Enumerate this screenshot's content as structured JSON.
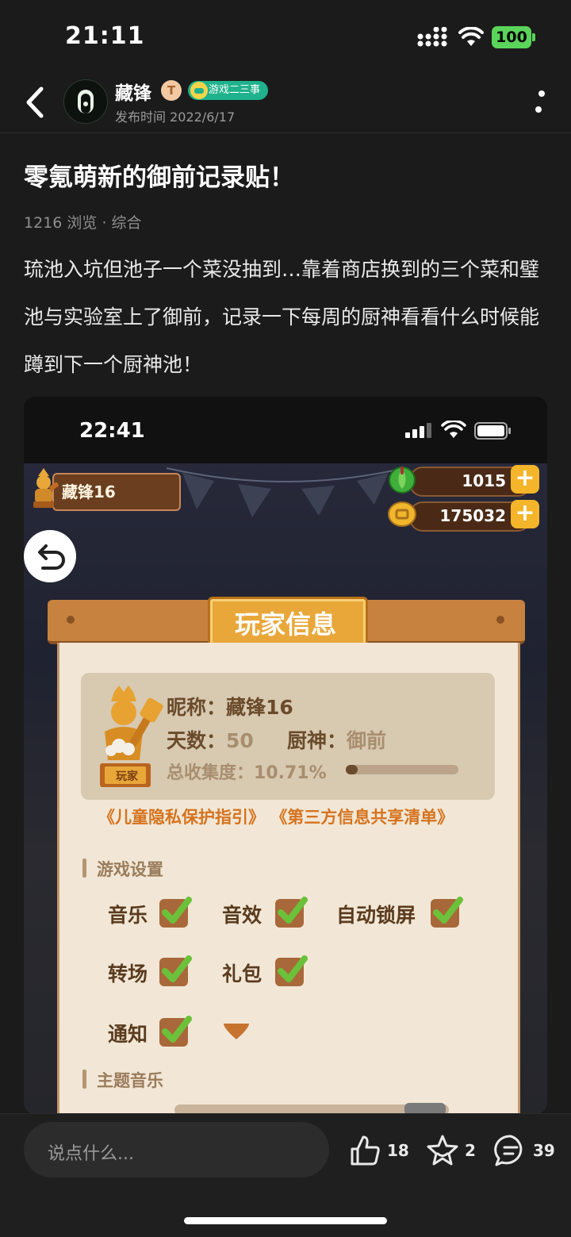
{
  "status_bar": {
    "time": "21:11",
    "battery": "100"
  },
  "header": {
    "author": "藏锋",
    "level_badge": "T",
    "tag": "游戏二三事",
    "publish_time": "发布时间 2022/6/17"
  },
  "post": {
    "title": "零氪萌新的御前记录贴！",
    "views": "1216 浏览",
    "category": "综合",
    "body": "琉池入坑但池子一个菜没抽到…靠着商店换到的三个菜和璧池与实验室上了御前，记录一下每周的厨神看看什么时候能蹲到下一个厨神池！"
  },
  "screenshot": {
    "time": "22:41",
    "player_name": "藏锋16",
    "jade": "1015",
    "coins": "175032",
    "modal_title": "玩家信息",
    "nickname_label": "昵称：",
    "nickname": "藏锋16",
    "days_label": "天数：",
    "days": "50",
    "chef_label": "厨神：",
    "chef": "御前",
    "collection_label": "总收集度：",
    "collection": "10.71%",
    "collection_fraction": 0.1071,
    "statue_label": "玩家",
    "link_privacy": "《儿童隐私保护指引》",
    "link_thirdparty": "《第三方信息共享清单》",
    "section_settings": "游戏设置",
    "settings": {
      "music": "音乐",
      "sfx": "音效",
      "autolock": "自动锁屏",
      "transition": "转场",
      "gift": "礼包",
      "notify": "通知"
    },
    "section_theme": "主题音乐"
  },
  "bottom": {
    "comment_placeholder": "说点什么...",
    "likes": "18",
    "favorites": "2",
    "comments": "39"
  }
}
